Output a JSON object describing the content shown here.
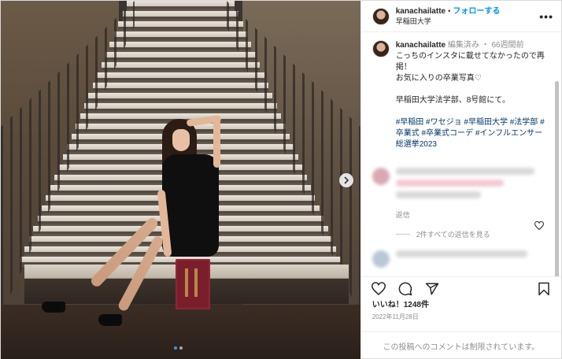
{
  "post": {
    "username": "kanachailatte",
    "follow_label": "フォローする",
    "separator": "•",
    "location": "早稲田大学",
    "more_icon": "more-horizontal-icon"
  },
  "caption": {
    "username": "kanachailatte",
    "edited": "編集済み",
    "time_ago": "66週間前",
    "line1": "こっちのインスタに載せてなかったので再掲！",
    "line2": "お気に入りの卒業写真♡",
    "line3": "早稲田大学法学部、8号館にて。",
    "hashtags": "#早稲田 #ワセジョ #早稲田大学 #法学部 #卒業式 #卒業式コーデ #インフルエンサー総選挙2023"
  },
  "comments": {
    "reply_label": "返信",
    "view_replies_label": "2件すべての返信を見る"
  },
  "actions": {
    "like_icon": "heart-icon",
    "comment_icon": "comment-icon",
    "share_icon": "share-icon",
    "save_icon": "bookmark-icon"
  },
  "stats": {
    "likes": "いいね！1248件",
    "date": "2022年11月28日"
  },
  "footer": {
    "comments_limited": "この投稿へのコメントは制限されています。"
  },
  "carousel": {
    "next_icon": "chevron-right-icon",
    "slide_count": 2,
    "current_slide": 1
  },
  "colors": {
    "accent": "#0095f6",
    "hashtag": "#00376b",
    "muted": "#8e8e8e"
  }
}
